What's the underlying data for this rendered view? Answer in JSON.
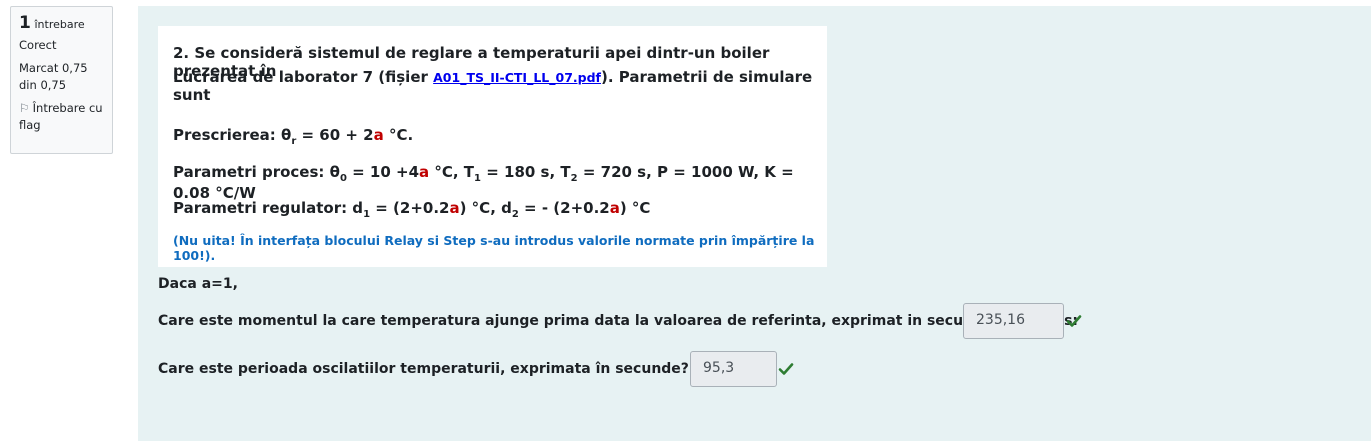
{
  "question_info": {
    "number": "1",
    "number_label": "întrebare",
    "state": "Corect",
    "grade": "Marcat 0,75 din 0,75",
    "flag_label": "Întrebare cu flag"
  },
  "problem": {
    "line1": "2. Se consideră sistemul de reglare a temperaturii apei dintr-un boiler prezentat în",
    "line2_prefix": "Lucrarea de laborator 7 (fișier ",
    "link_text": "A01_TS_II-CTI_LL_07.pdf",
    "line2_suffix": ").  Parametrii de simulare sunt",
    "prescription_label": "Prescrierea: θ",
    "prescription_sub": "r",
    "prescription_mid": " = 60 + 2",
    "a_symbol": "a",
    "prescription_unit": "  °C.",
    "process_label": "Parametri proces: θ",
    "process_sub0": "0",
    "process_mid": " = 10 +4",
    "process_rest1": " °C, T",
    "process_sub1": "1",
    "process_rest2": " = 180 s, T",
    "process_sub2": "2",
    "process_rest3": " = 720 s, P = 1000 W, K = 0.08 °C/W",
    "regulator_label": "Parametri regulator: d",
    "reg_sub1": "1",
    "reg_mid1": " = (2+0.2",
    "reg_mid2": ") °C, d",
    "reg_sub2": "2",
    "reg_mid3": " = - (2+0.2",
    "reg_end": ") °C",
    "note": "(Nu uita! În interfața blocului Relay si Step s-au introdus valorile normate prin împărțire la 100!)."
  },
  "daca": "Daca a=1,",
  "q1_text": "Care este momentul la care temperatura ajunge prima data la valoarea de referinta, exprimat in secunde? Raspuns:",
  "q1_answer": "235,16",
  "q2_text": "Care este perioada oscilatiilor temperaturii, exprimata în secunde? Raspuns:",
  "q2_answer": "95,3",
  "colors": {
    "correct": "#2e7d32",
    "accent_red": "#c00000",
    "note_blue": "#0f6cbf",
    "panel": "#e7f2f3"
  }
}
